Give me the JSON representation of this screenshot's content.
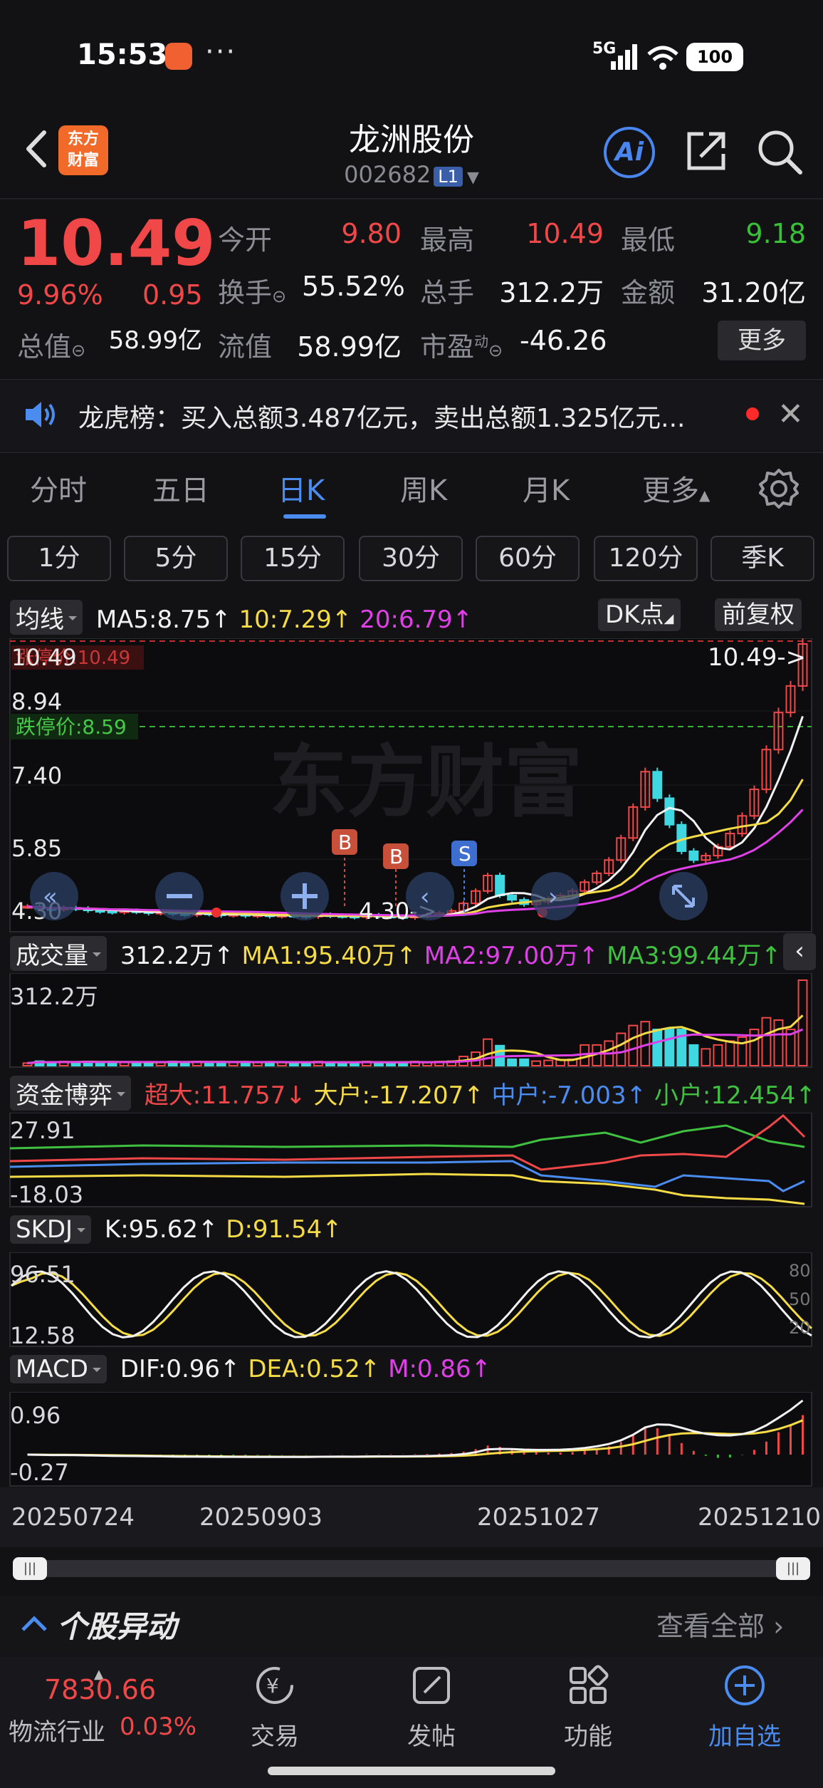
{
  "status": {
    "time": "15:53",
    "dots": "···",
    "net": "5G",
    "battery": "100"
  },
  "header": {
    "logo": "东方\n财富",
    "name": "龙洲股份",
    "code": "002682",
    "level": "L1",
    "ai": "Ai"
  },
  "quote": {
    "price": "10.49",
    "pct": "9.96%",
    "change": "0.95",
    "fields": [
      {
        "label": "今开",
        "value": "9.80",
        "color": "red"
      },
      {
        "label": "最高",
        "value": "10.49",
        "color": "red"
      },
      {
        "label": "最低",
        "value": "9.18",
        "color": "green"
      },
      {
        "label": "换手",
        "value": "55.52%",
        "color": "white"
      },
      {
        "label": "总手",
        "value": "312.2万",
        "color": "white"
      },
      {
        "label": "金额",
        "value": "31.20亿",
        "color": "white"
      },
      {
        "label": "总值",
        "value": "58.99亿",
        "color": "white"
      },
      {
        "label": "流值",
        "value": "58.99亿",
        "color": "white"
      },
      {
        "label": "市盈",
        "value": "-46.26",
        "color": "white"
      }
    ],
    "pe_sup": "动",
    "more": "更多"
  },
  "notice": {
    "text": "龙虎榜：买入总额3.487亿元，卖出总额1.325亿元..."
  },
  "tabs": [
    "分时",
    "五日",
    "日K",
    "周K",
    "月K",
    "更多"
  ],
  "active_tab": "日K",
  "minute_buttons": [
    "1分",
    "5分",
    "15分",
    "30分",
    "60分",
    "120分",
    "季K"
  ],
  "main_chart": {
    "dropdown": "均线",
    "ma5": "MA5:8.75↑",
    "ma10": "10:7.29↑",
    "ma20": "20:6.79↑",
    "dk": "DK点",
    "adjust": "前复权",
    "limit_up": "涨停价:10.49",
    "limit_down": "跌停价:8.59",
    "y_labels": [
      "10.49",
      "8.94",
      "7.40",
      "5.85",
      "4.30"
    ],
    "last_label": "10.49->",
    "low_label": "4.30->",
    "markers": [
      "B",
      "B",
      "S"
    ],
    "watermark": "东方财富"
  },
  "volume": {
    "dropdown": "成交量",
    "value": "312.2万↑",
    "ma1": "MA1:95.40万↑",
    "ma2": "MA2:97.00万↑",
    "ma3": "MA3:99.44万↑",
    "y_label": "312.2万"
  },
  "fund": {
    "dropdown": "资金博弈",
    "super": "超大:11.757↓",
    "large": "大户:-17.207↑",
    "mid": "中户:-7.003↑",
    "small": "小户:12.454↑",
    "y_top": "27.91",
    "y_bottom": "-18.03"
  },
  "skdj": {
    "dropdown": "SKDJ",
    "k": "K:95.62↑",
    "d": "D:91.54↑",
    "y_top": "96.51",
    "y_bottom": "12.58",
    "right_ticks": [
      "80",
      "50",
      "20"
    ]
  },
  "macd": {
    "dropdown": "MACD",
    "dif": "DIF:0.96↑",
    "dea": "DEA:0.52↑",
    "m": "M:0.86↑",
    "y_top": "0.96",
    "y_bottom": "-0.27"
  },
  "dates": [
    "20250724",
    "20250903",
    "20251027",
    "20251210"
  ],
  "section": {
    "title": "个股异动",
    "link": "查看全部"
  },
  "bottom": {
    "index_value": "7830.66",
    "index_name": "物流行业",
    "index_pct": "0.03%",
    "items": [
      {
        "label": "交易",
        "icon": "trade-icon"
      },
      {
        "label": "发帖",
        "icon": "post-icon"
      },
      {
        "label": "功能",
        "icon": "grid-icon"
      },
      {
        "label": "加自选",
        "icon": "add-watch-icon"
      }
    ]
  },
  "chart_data": {
    "type": "candlestick",
    "close_series": [
      4.55,
      4.5,
      4.48,
      4.52,
      4.5,
      4.46,
      4.44,
      4.42,
      4.45,
      4.43,
      4.4,
      4.42,
      4.38,
      4.36,
      4.4,
      4.38,
      4.35,
      4.37,
      4.34,
      4.36,
      4.33,
      4.35,
      4.34,
      4.32,
      4.36,
      4.34,
      4.33,
      4.31,
      4.35,
      4.33,
      4.32,
      4.3,
      4.34,
      4.36,
      4.4,
      4.45,
      4.62,
      4.9,
      5.25,
      4.8,
      4.7,
      4.6,
      4.65,
      4.72,
      4.8,
      4.9,
      5.1,
      5.3,
      5.6,
      6.1,
      6.8,
      7.6,
      7.0,
      6.4,
      5.8,
      5.6,
      5.7,
      5.9,
      6.2,
      6.6,
      7.2,
      8.1,
      8.94,
      9.54,
      10.49
    ],
    "y_range": [
      4.3,
      10.49
    ],
    "limit_up": 10.49,
    "limit_down": 8.59
  }
}
